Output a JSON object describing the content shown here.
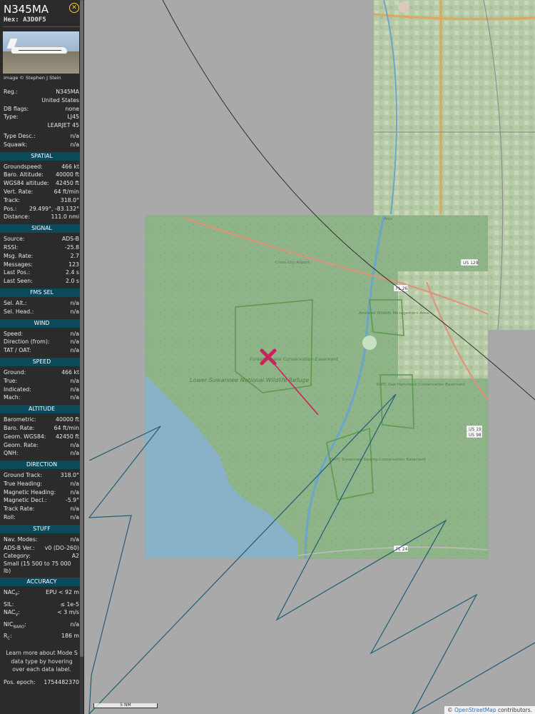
{
  "aircraft": {
    "callsign": "N345MA",
    "hex_label": "Hex:",
    "hex": "A3D0F5",
    "photo_credit": "Image © Stephen J Stein"
  },
  "info": {
    "reg_label": "Reg.:",
    "reg": "N345MA",
    "country": "United States",
    "dbflags_label": "DB flags:",
    "dbflags": "none",
    "type_label": "Type:",
    "type": "LJ45",
    "type_name": "LEARJET 45",
    "typedesc_label": "Type Desc.:",
    "typedesc": "n/a",
    "squawk_label": "Squawk:",
    "squawk": "n/a"
  },
  "spatial": {
    "title": "SPATIAL",
    "rows": [
      {
        "k": "Groundspeed:",
        "v": "466 kt"
      },
      {
        "k": "Baro. Altitude:",
        "v": "40000 ft"
      },
      {
        "k": "WGS84 altitude:",
        "v": "42450 ft"
      },
      {
        "k": "Vert. Rate:",
        "v": "64 ft/min"
      },
      {
        "k": "Track:",
        "v": "318.0°"
      },
      {
        "k": "Pos.:",
        "v": "29.499°, -83.132°"
      },
      {
        "k": "Distance:",
        "v": "111.0 nmi"
      }
    ]
  },
  "signal": {
    "title": "SIGNAL",
    "rows": [
      {
        "k": "Source:",
        "v": "ADS-B"
      },
      {
        "k": "RSSI:",
        "v": "-25.8"
      },
      {
        "k": "Msg. Rate:",
        "v": "2.7"
      },
      {
        "k": "Messages:",
        "v": "123"
      },
      {
        "k": "Last Pos.:",
        "v": "2.4 s"
      },
      {
        "k": "Last Seen:",
        "v": "2.0 s"
      }
    ]
  },
  "fms": {
    "title": "FMS SEL",
    "rows": [
      {
        "k": "Sel. Alt.:",
        "v": "n/a"
      },
      {
        "k": "Sel. Head.:",
        "v": "n/a"
      }
    ]
  },
  "wind": {
    "title": "WIND",
    "rows": [
      {
        "k": "Speed:",
        "v": "n/a"
      },
      {
        "k": "Direction (from):",
        "v": "n/a"
      },
      {
        "k": "TAT / OAT:",
        "v": "n/a"
      }
    ]
  },
  "speed": {
    "title": "SPEED",
    "rows": [
      {
        "k": "Ground:",
        "v": "466 kt"
      },
      {
        "k": "True:",
        "v": "n/a"
      },
      {
        "k": "Indicated:",
        "v": "n/a"
      },
      {
        "k": "Mach:",
        "v": "n/a"
      }
    ]
  },
  "altitude": {
    "title": "ALTITUDE",
    "rows": [
      {
        "k": "Barometric:",
        "v": "40000 ft"
      },
      {
        "k": "Baro. Rate:",
        "v": "64 ft/min"
      },
      {
        "k": "Geom. WGS84:",
        "v": "42450 ft"
      },
      {
        "k": "Geom. Rate:",
        "v": "n/a"
      },
      {
        "k": "QNH:",
        "v": "n/a"
      }
    ]
  },
  "direction": {
    "title": "DIRECTION",
    "rows": [
      {
        "k": "Ground Track:",
        "v": "318.0°"
      },
      {
        "k": "True Heading:",
        "v": "n/a"
      },
      {
        "k": "Magnetic Heading:",
        "v": "n/a"
      },
      {
        "k": "Magnetic Decl.:",
        "v": "-5.9°"
      },
      {
        "k": "Track Rate:",
        "v": "n/a"
      },
      {
        "k": "Roll:",
        "v": "n/a"
      }
    ]
  },
  "stuff": {
    "title": "STUFF",
    "rows": [
      {
        "k": "Nav. Modes:",
        "v": "n/a"
      },
      {
        "k": "ADS-B Ver.:",
        "v": "v0 (DO-260)"
      },
      {
        "k": "Category:",
        "v": "A2"
      }
    ],
    "category_desc": "Small (15 500 to 75 000 lb)"
  },
  "accuracy": {
    "title": "ACCURACY",
    "nacp_k": "NAC",
    "nacp_sub": "P",
    "nacp_v": "EPU < 92 m",
    "sil_k": "SIL:",
    "sil_v": "≤ 1e-5",
    "nacv_k": "NAC",
    "nacv_sub": "V",
    "nacv_v": "< 3 m/s",
    "nicbaro_k": "NIC",
    "nicbaro_sub": "BARO",
    "nicbaro_v": "n/a",
    "rc_k": "R",
    "rc_sub": "C",
    "rc_v": "186 m"
  },
  "note": "Learn more about Mode S data type by hovering over each data label.",
  "pos_epoch_label": "Pos. epoch:",
  "pos_epoch": "1754482370",
  "map": {
    "labels": {
      "cross_city": "Cross City Airport",
      "andrews": "Andrews Wildlife Management Area",
      "forest_steans": "Forest Steans Conservation Easement",
      "lower_suwannee": "Lower Suwannee National Wildlife Refuge",
      "natc_oak": "NATC Oak Hammock Conservation Easement",
      "natc_suwannee": "NATC Suwannee Swamp Conservation Easement",
      "us129": "US 129",
      "fl26": "FL 26",
      "us19": "US 19",
      "us98": "US 98",
      "fl24": "FL 24",
      "arco": "Arco"
    },
    "scale": "5 NM",
    "attribution_prefix": "© ",
    "attribution_link": "OpenStreetMap",
    "attribution_suffix": " contributors."
  }
}
